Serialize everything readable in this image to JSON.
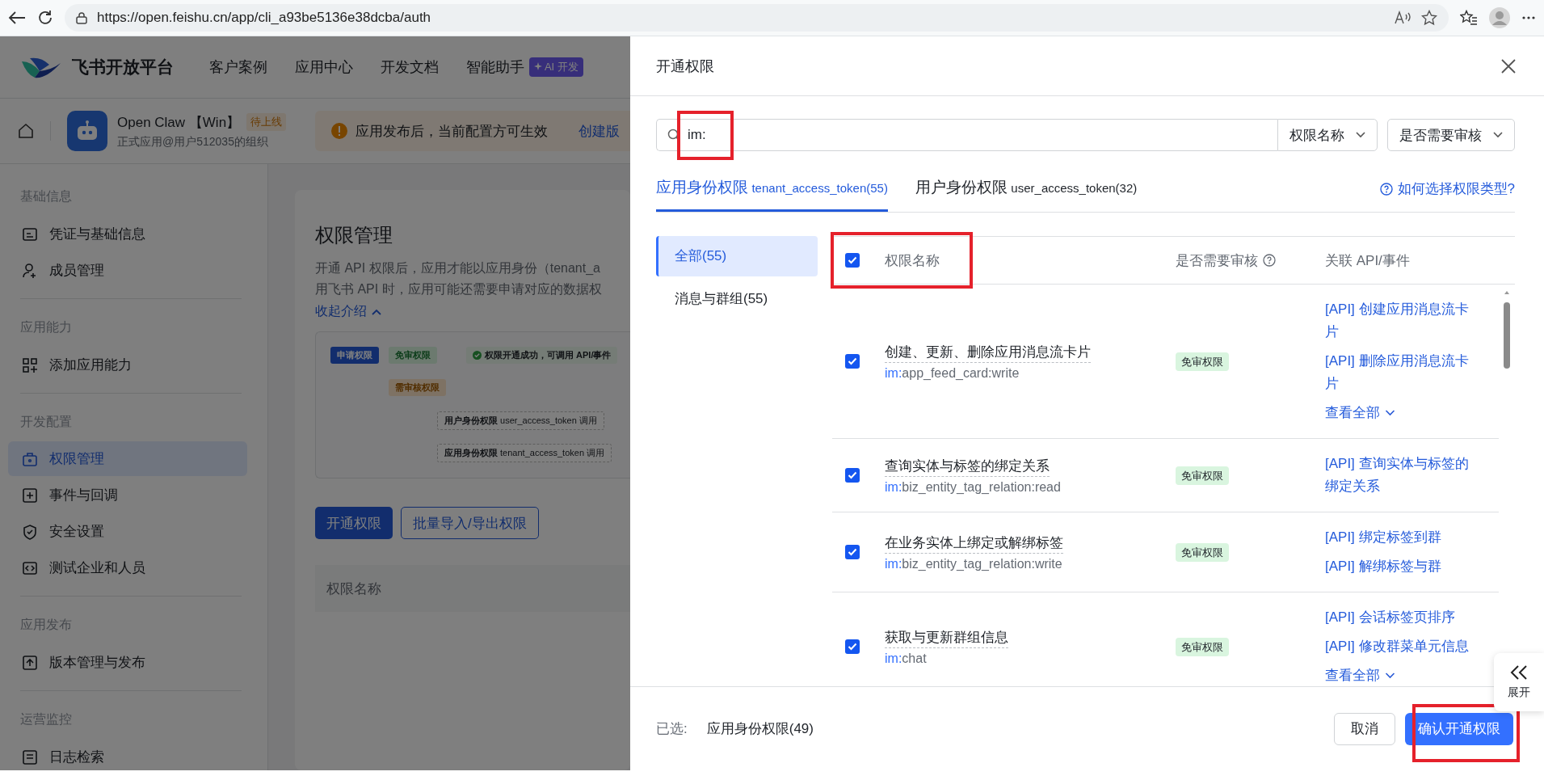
{
  "browser": {
    "url": "https://open.feishu.cn/app/cli_a93be5136e38dcba/auth"
  },
  "site_nav": {
    "logo": "飞书开放平台",
    "items": [
      {
        "label": "客户案例"
      },
      {
        "label": "应用中心"
      },
      {
        "label": "开发文档"
      },
      {
        "label": "智能助手",
        "badge": "AI 开发"
      }
    ]
  },
  "app_bar": {
    "name": "Open Claw 【Win】",
    "status": "待上线",
    "org": "正式应用@用户512035的组织",
    "notice": "应用发布后，当前配置方可生效",
    "notice_link": "创建版"
  },
  "sidebar": [
    {
      "group": "基础信息",
      "items": [
        {
          "label": "凭证与基础信息",
          "selected": false
        },
        {
          "label": "成员管理",
          "selected": false
        }
      ]
    },
    {
      "group": "应用能力",
      "items": [
        {
          "label": "添加应用能力",
          "selected": false
        }
      ]
    },
    {
      "group": "开发配置",
      "items": [
        {
          "label": "权限管理",
          "selected": true
        },
        {
          "label": "事件与回调",
          "selected": false
        },
        {
          "label": "安全设置",
          "selected": false
        },
        {
          "label": "测试企业和人员",
          "selected": false
        }
      ]
    },
    {
      "group": "应用发布",
      "items": [
        {
          "label": "版本管理与发布",
          "selected": false
        }
      ]
    },
    {
      "group": "运营监控",
      "items": [
        {
          "label": "日志检索",
          "selected": false
        }
      ]
    }
  ],
  "content": {
    "title": "权限管理",
    "description": [
      "开通 API 权限后，应用才能以应用身份（tenant_a",
      "用飞书 API 时，应用可能还需要申请对应的数据权"
    ],
    "collapse_link": "收起介绍",
    "flow": {
      "start": "申请权限",
      "free": "免审权限",
      "success": "权限开通成功，可调用 API/事件",
      "review": "需审核权限",
      "user": "用户身份权限",
      "user_token": "user_access_token 调用",
      "tenant": "应用身份权限",
      "tenant_token": "tenant_access_token 调用"
    },
    "buttons": [
      {
        "label": "开通权限",
        "kind": "primary"
      },
      {
        "label": "批量导入/导出权限",
        "kind": "outline"
      }
    ],
    "table_header": "权限名称"
  },
  "dialog": {
    "title": "开通权限",
    "search": {
      "value": "im:",
      "highlighted": true
    },
    "filters": [
      {
        "label": "权限名称"
      },
      {
        "label": "是否需要审核"
      }
    ],
    "tabs": [
      {
        "label": "应用身份权限",
        "token": "tenant_access_token(55)",
        "selected": true
      },
      {
        "label": "用户身份权限",
        "token": "user_access_token(32)",
        "selected": false
      }
    ],
    "help_link": "如何选择权限类型?",
    "categories": [
      {
        "label": "全部(55)",
        "selected": true
      },
      {
        "label": "消息与群组(55)",
        "selected": false
      }
    ],
    "table": {
      "header_checked": true,
      "header_highlighted": true,
      "columns": [
        "权限名称",
        "是否需要审核",
        "关联 API/事件"
      ],
      "rows": [
        {
          "checked": true,
          "name": "创建、更新、删除应用消息流卡片",
          "scope": "im:app_feed_card:write",
          "review": "免审权限",
          "apis": [
            "[API] 创建应用消息流卡片",
            "[API] 删除应用消息流卡片"
          ],
          "view_all": "查看全部"
        },
        {
          "checked": true,
          "name": "查询实体与标签的绑定关系",
          "scope": "im:biz_entity_tag_relation:read",
          "review": "免审权限",
          "apis": [
            "[API] 查询实体与标签的绑定关系"
          ]
        },
        {
          "checked": true,
          "name": "在业务实体上绑定或解绑标签",
          "scope": "im:biz_entity_tag_relation:write",
          "review": "免审权限",
          "apis": [
            "[API] 绑定标签到群",
            "[API] 解绑标签与群"
          ]
        },
        {
          "checked": true,
          "name": "获取与更新群组信息",
          "scope": "im:chat",
          "review": "免审权限",
          "apis": [
            "[API] 会话标签页排序",
            "[API] 修改群菜单元信息"
          ],
          "view_all": "查看全部"
        }
      ]
    },
    "footer": {
      "selected_label": "已选:",
      "selected_value": "应用身份权限(49)",
      "cancel": "取消",
      "confirm": "确认开通权限",
      "confirm_highlighted": true
    },
    "side_tab": "展开"
  }
}
